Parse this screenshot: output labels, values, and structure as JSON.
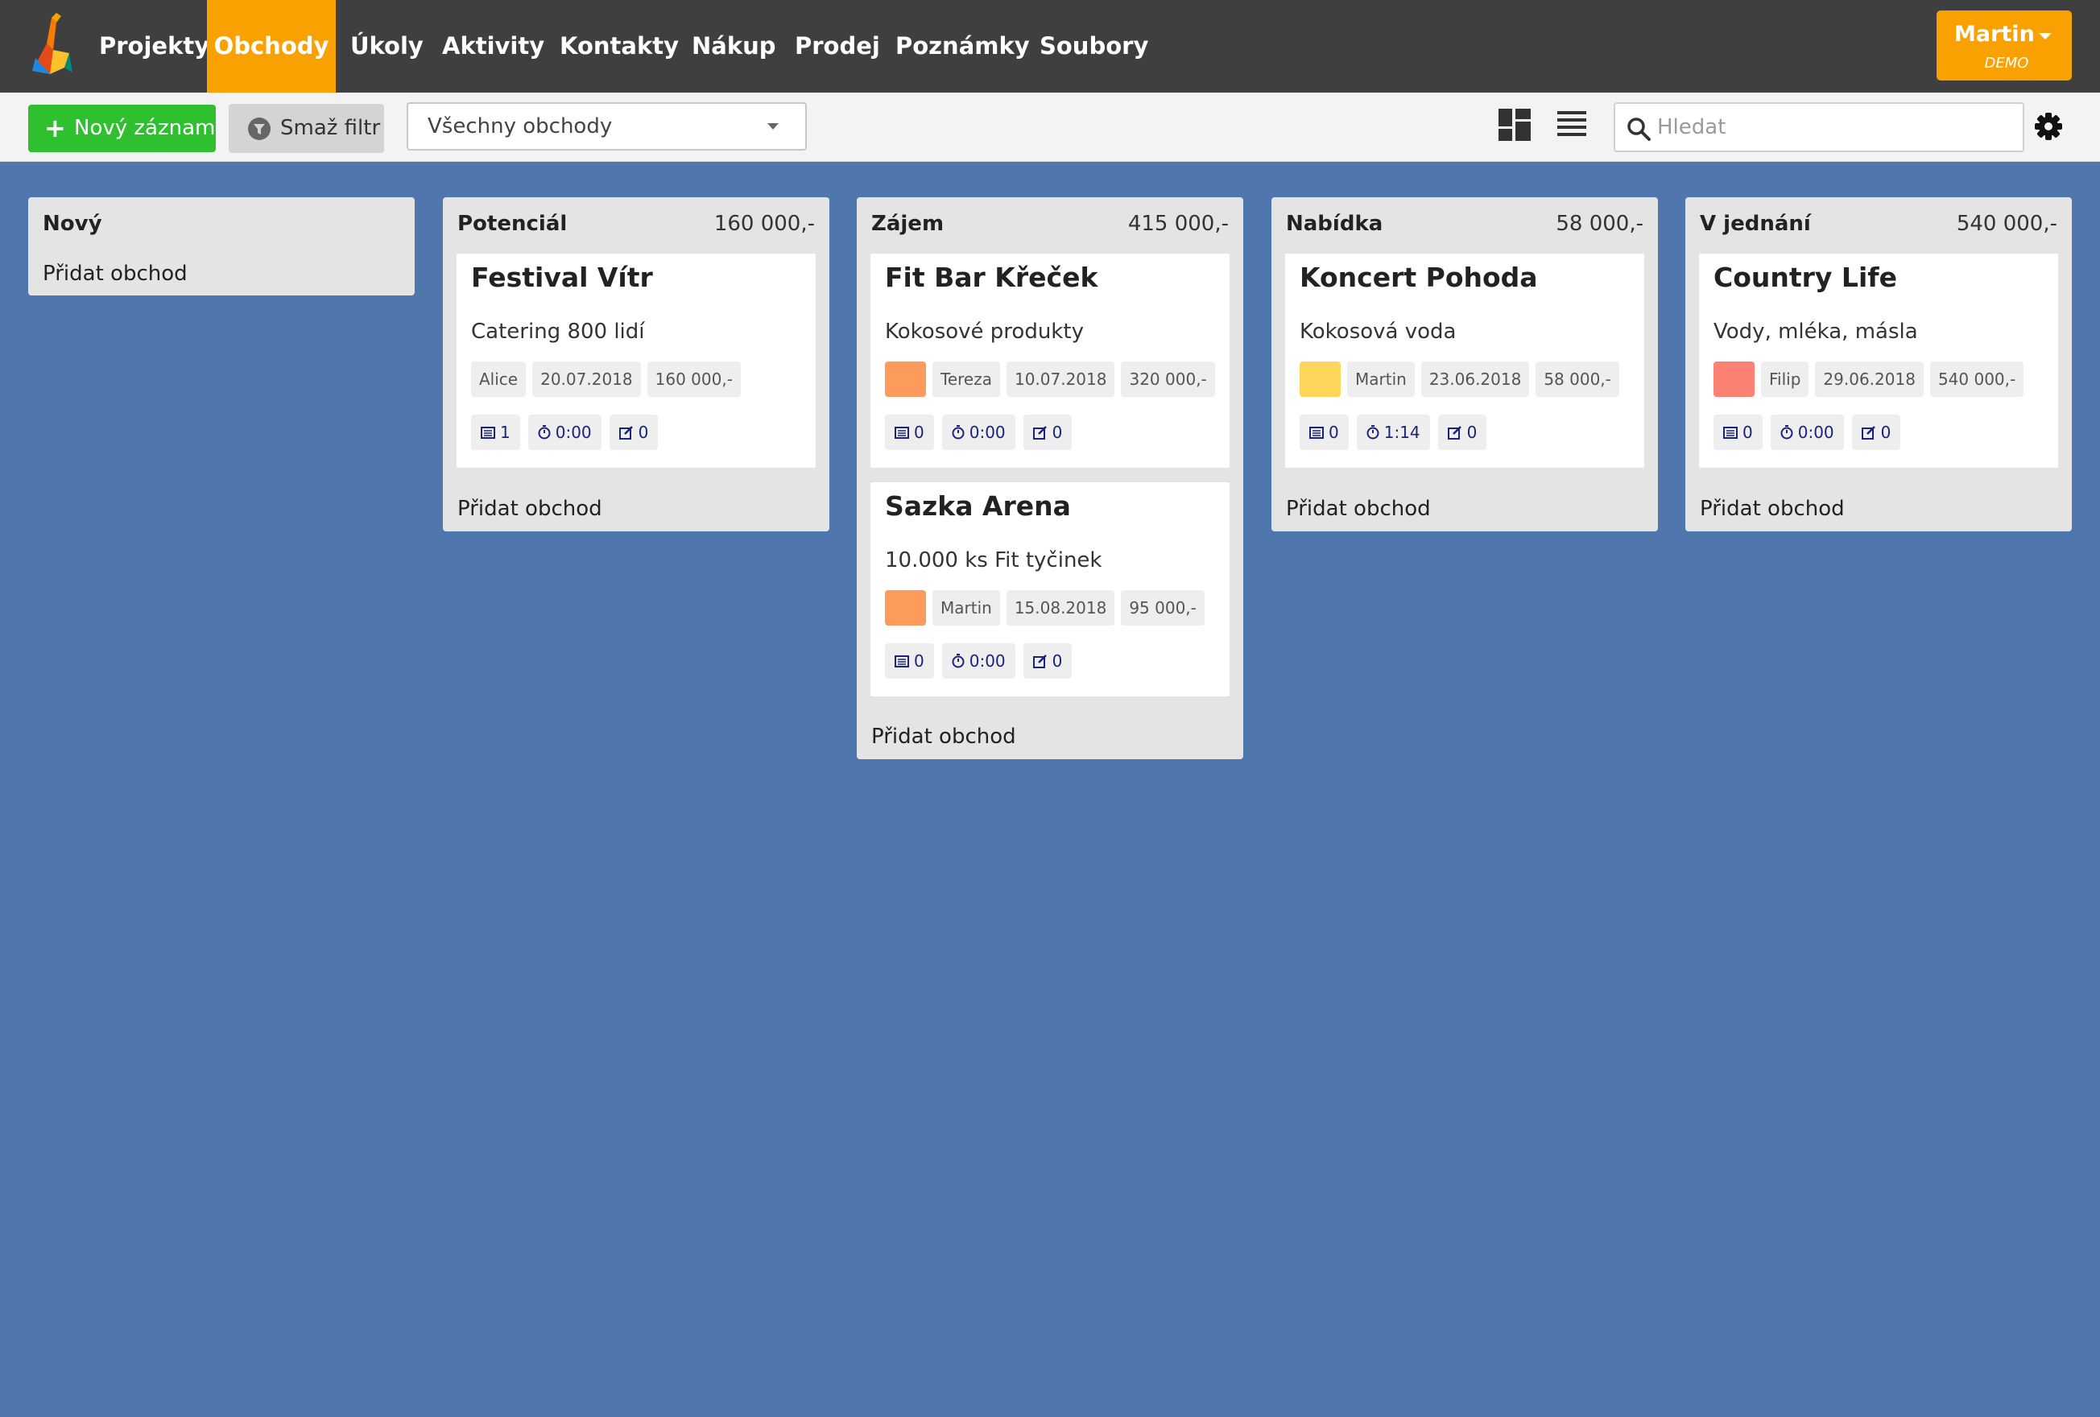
{
  "nav": {
    "items": [
      {
        "label": "Projekty",
        "active": false
      },
      {
        "label": "Obchody",
        "active": true
      },
      {
        "label": "Úkoly",
        "active": false
      },
      {
        "label": "Aktivity",
        "active": false
      },
      {
        "label": "Kontakty",
        "active": false
      },
      {
        "label": "Nákup",
        "active": false
      },
      {
        "label": "Prodej",
        "active": false
      },
      {
        "label": "Poznámky",
        "active": false
      },
      {
        "label": "Soubory",
        "active": false
      }
    ],
    "user": {
      "name": "Martin",
      "tag": "DEMO"
    }
  },
  "toolbar": {
    "new_label": "Nový záznam",
    "filter_label": "Smaž filtr",
    "select_value": "Všechny obchody",
    "search_placeholder": "Hledat"
  },
  "colors": {
    "accent": "#f9a100",
    "success": "#2ec02e",
    "board": "#4f77ad",
    "nav_bg": "#3f3f3f"
  },
  "columns": [
    {
      "title": "Nový",
      "sum": "",
      "add_label": "Přidat obchod",
      "cards": []
    },
    {
      "title": "Potenciál",
      "sum": "160 000,-",
      "add_label": "Přidat obchod",
      "cards": [
        {
          "title": "Festival Vítr",
          "desc": "Catering 800 lidí",
          "color": "",
          "person": "Alice",
          "date": "20.07.2018",
          "amount": "160 000,-",
          "stats": {
            "records": "1",
            "time": "0:00",
            "notes": "0"
          }
        }
      ]
    },
    {
      "title": "Zájem",
      "sum": "415 000,-",
      "add_label": "Přidat obchod",
      "cards": [
        {
          "title": "Fit Bar Křeček",
          "desc": "Kokosové produkty",
          "color": "#fd9b5c",
          "person": "Tereza",
          "date": "10.07.2018",
          "amount": "320 000,-",
          "stats": {
            "records": "0",
            "time": "0:00",
            "notes": "0"
          }
        },
        {
          "title": "Sazka Arena",
          "desc": "10.000 ks Fit tyčinek",
          "color": "#fd9b5c",
          "person": "Martin",
          "date": "15.08.2018",
          "amount": "95 000,-",
          "stats": {
            "records": "0",
            "time": "0:00",
            "notes": "0"
          }
        }
      ]
    },
    {
      "title": "Nabídka",
      "sum": "58 000,-",
      "add_label": "Přidat obchod",
      "cards": [
        {
          "title": "Koncert Pohoda",
          "desc": "Kokosová voda",
          "color": "#ffd65c",
          "person": "Martin",
          "date": "23.06.2018",
          "amount": "58 000,-",
          "stats": {
            "records": "0",
            "time": "1:14",
            "notes": "0"
          }
        }
      ]
    },
    {
      "title": "V jednání",
      "sum": "540 000,-",
      "add_label": "Přidat obchod",
      "cards": [
        {
          "title": "Country Life",
          "desc": "Vody, mléka, másla",
          "color": "#fb8172",
          "person": "Filip",
          "date": "29.06.2018",
          "amount": "540 000,-",
          "stats": {
            "records": "0",
            "time": "0:00",
            "notes": "0"
          }
        }
      ]
    }
  ]
}
